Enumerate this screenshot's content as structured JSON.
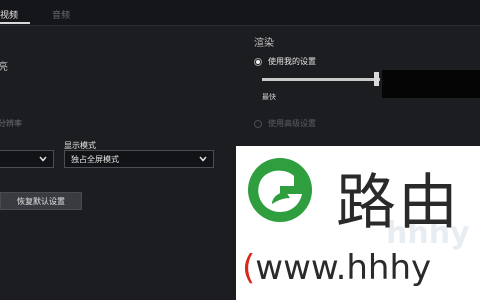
{
  "tabs": [
    {
      "label": "视频"
    },
    {
      "label": "音频"
    }
  ],
  "left": {
    "section_title": "亮",
    "muted_label": "分辨率",
    "display_mode_label": "显示模式",
    "resolution_value": "",
    "display_mode_value": "独占全屏模式",
    "reset_button": "恢复默认设置"
  },
  "right": {
    "section_title": "渲染",
    "radio_use_app": "使用我的设置",
    "slider_caption": "最快",
    "radio_use_3d": "使用高级设置"
  },
  "watermark": {
    "chinese": "路由",
    "url_paren": "(",
    "url_text": "www.hhhy",
    "ghost": "hhhy"
  },
  "colors": {
    "background": "#1c1d20",
    "logo_green": "#2e9e3f",
    "watermark_paren": "#d9261c"
  }
}
